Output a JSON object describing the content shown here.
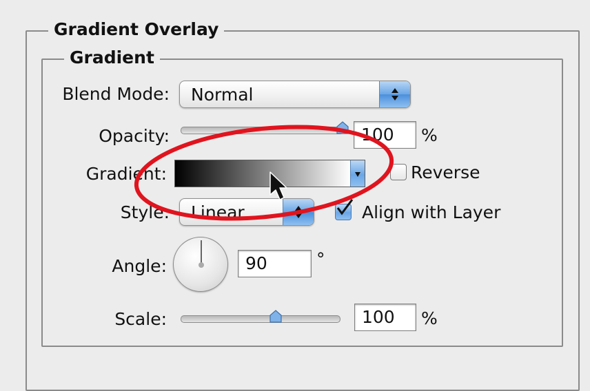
{
  "panel": {
    "outer_title": "Gradient Overlay",
    "inner_title": "Gradient"
  },
  "blend_mode": {
    "label": "Blend Mode:",
    "value": "Normal"
  },
  "opacity": {
    "label": "Opacity:",
    "value": "100",
    "unit": "%",
    "slider_fraction": 1.0
  },
  "gradient": {
    "label": "Gradient:",
    "stops": [
      "#000000",
      "#ffffff"
    ]
  },
  "reverse": {
    "label": "Reverse",
    "checked": false
  },
  "style": {
    "label": "Style:",
    "value": "Linear"
  },
  "align_with_layer": {
    "label": "Align with Layer",
    "checked": true
  },
  "angle": {
    "label": "Angle:",
    "value": "90",
    "unit": "°",
    "degrees": 90
  },
  "scale": {
    "label": "Scale:",
    "value": "100",
    "unit": "%",
    "slider_fraction": 0.6
  },
  "colors": {
    "accent_blue": "#6aa6e6",
    "highlight_ellipse": "#e0141e",
    "background": "#ececec"
  },
  "icons": {
    "cursor": "mouse-pointer-icon",
    "checkmark": "checkmark-icon",
    "stepper": "up-down-arrows-icon",
    "dropdown": "chevron-down-icon"
  }
}
